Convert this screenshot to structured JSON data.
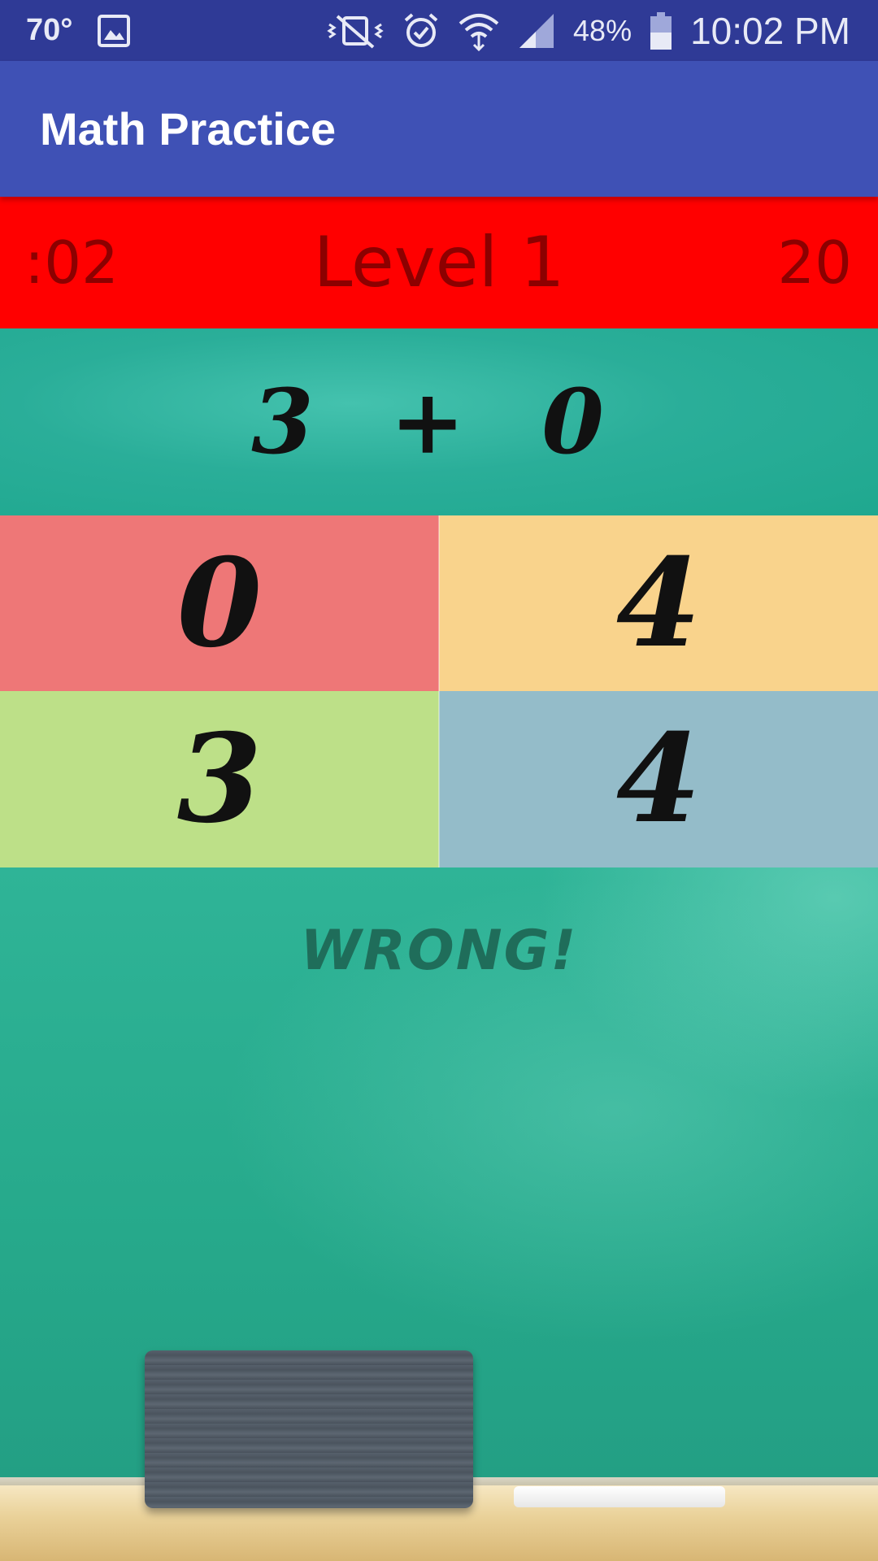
{
  "status_bar": {
    "temperature": "70°",
    "battery_percent": "48%",
    "time": "10:02 PM",
    "icons": [
      "image-icon",
      "vibrate-off-icon",
      "alarm-icon",
      "wifi-icon",
      "signal-icon",
      "battery-icon"
    ]
  },
  "app_bar": {
    "title": "Math Practice"
  },
  "level_bar": {
    "timer": ":02",
    "level": "Level 1",
    "score": "20",
    "background": "#ff0000"
  },
  "question": {
    "text": "3 + 0"
  },
  "answers": [
    {
      "label": "0",
      "color": "#ee7777"
    },
    {
      "label": "4",
      "color": "#f9d38c"
    },
    {
      "label": "3",
      "color": "#bde088"
    },
    {
      "label": "4",
      "color": "#94bcc9"
    }
  ],
  "feedback": {
    "text": "WRONG!"
  }
}
